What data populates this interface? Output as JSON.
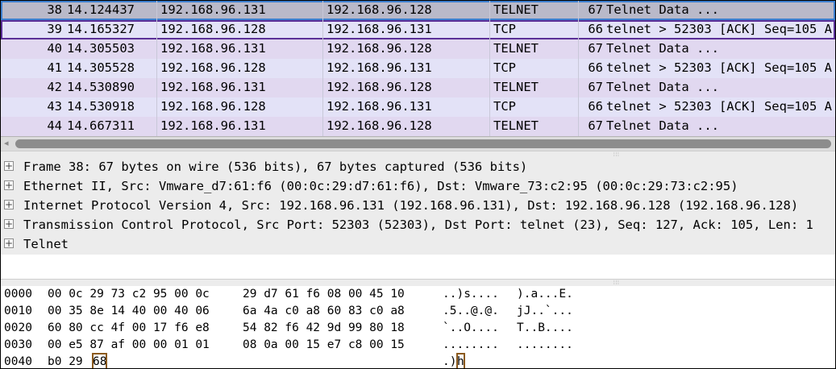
{
  "packets": [
    {
      "no": "38",
      "time": "14.124437",
      "src": "192.168.96.131",
      "dst": "192.168.96.128",
      "proto": "TELNET",
      "len": "67",
      "info": "Telnet Data ...",
      "state": "selected"
    },
    {
      "no": "39",
      "time": "14.165327",
      "src": "192.168.96.128",
      "dst": "192.168.96.131",
      "proto": "TCP",
      "len": "66",
      "info": "telnet > 52303 [ACK] Seq=105 A",
      "state": "focused"
    },
    {
      "no": "40",
      "time": "14.305503",
      "src": "192.168.96.131",
      "dst": "192.168.96.128",
      "proto": "TELNET",
      "len": "67",
      "info": "Telnet Data ...",
      "state": ""
    },
    {
      "no": "41",
      "time": "14.305528",
      "src": "192.168.96.128",
      "dst": "192.168.96.131",
      "proto": "TCP",
      "len": "66",
      "info": "telnet > 52303 [ACK] Seq=105 A",
      "state": ""
    },
    {
      "no": "42",
      "time": "14.530890",
      "src": "192.168.96.131",
      "dst": "192.168.96.128",
      "proto": "TELNET",
      "len": "67",
      "info": "Telnet Data ...",
      "state": ""
    },
    {
      "no": "43",
      "time": "14.530918",
      "src": "192.168.96.128",
      "dst": "192.168.96.131",
      "proto": "TCP",
      "len": "66",
      "info": "telnet > 52303 [ACK] Seq=105 A",
      "state": ""
    },
    {
      "no": "44",
      "time": "14.667311",
      "src": "192.168.96.131",
      "dst": "192.168.96.128",
      "proto": "TELNET",
      "len": "67",
      "info": "Telnet Data ...",
      "state": ""
    }
  ],
  "details": [
    {
      "expander": "+",
      "text": "Frame 38: 67 bytes on wire (536 bits), 67 bytes captured (536 bits)"
    },
    {
      "expander": "+",
      "text": "Ethernet II, Src: Vmware_d7:61:f6 (00:0c:29:d7:61:f6), Dst: Vmware_73:c2:95 (00:0c:29:73:c2:95)"
    },
    {
      "expander": "+",
      "text": "Internet Protocol Version 4, Src: 192.168.96.131 (192.168.96.131), Dst: 192.168.96.128 (192.168.96.128)"
    },
    {
      "expander": "+",
      "text": "Transmission Control Protocol, Src Port: 52303 (52303), Dst Port: telnet (23), Seq: 127, Ack: 105, Len: 1"
    },
    {
      "expander": "+",
      "text": "Telnet"
    }
  ],
  "hex_dump": [
    {
      "offset": "0000",
      "hex1": "00 0c 29 73 c2 95 00 0c",
      "hex2": "29 d7 61 f6 08 00 45 10",
      "ascii1": "..)s....",
      "ascii2": ").a...E."
    },
    {
      "offset": "0010",
      "hex1": "00 35 8e 14 40 00 40 06",
      "hex2": "6a 4a c0 a8 60 83 c0 a8",
      "ascii1": ".5..@.@.",
      "ascii2": "jJ..`..."
    },
    {
      "offset": "0020",
      "hex1": "60 80 cc 4f 00 17 f6 e8",
      "hex2": "54 82 f6 42 9d 99 80 18",
      "ascii1": "`..O....",
      "ascii2": "T..B...."
    },
    {
      "offset": "0030",
      "hex1": "00 e5 87 af 00 00 01 01",
      "hex2": "08 0a 00 15 e7 c8 00 15",
      "ascii1": "........",
      "ascii2": "........"
    },
    {
      "offset": "0040",
      "hex1": "b0 29",
      "hex2": "",
      "ascii1": ".)",
      "ascii2": "",
      "hl_hex": "68",
      "hl_ascii": "h"
    }
  ],
  "colors": {
    "telnet_row": "#e1d8f0",
    "tcp_row": "#e3e2f7",
    "selected_row": "#b9b9c9",
    "selection_outline": "#3c7fcf",
    "focus_outline": "#5a2f97",
    "byte_highlight": "#8b5a1e"
  },
  "icons": {
    "scroll_left": "◂",
    "splitter_grip": "⦙⦙⦙"
  }
}
